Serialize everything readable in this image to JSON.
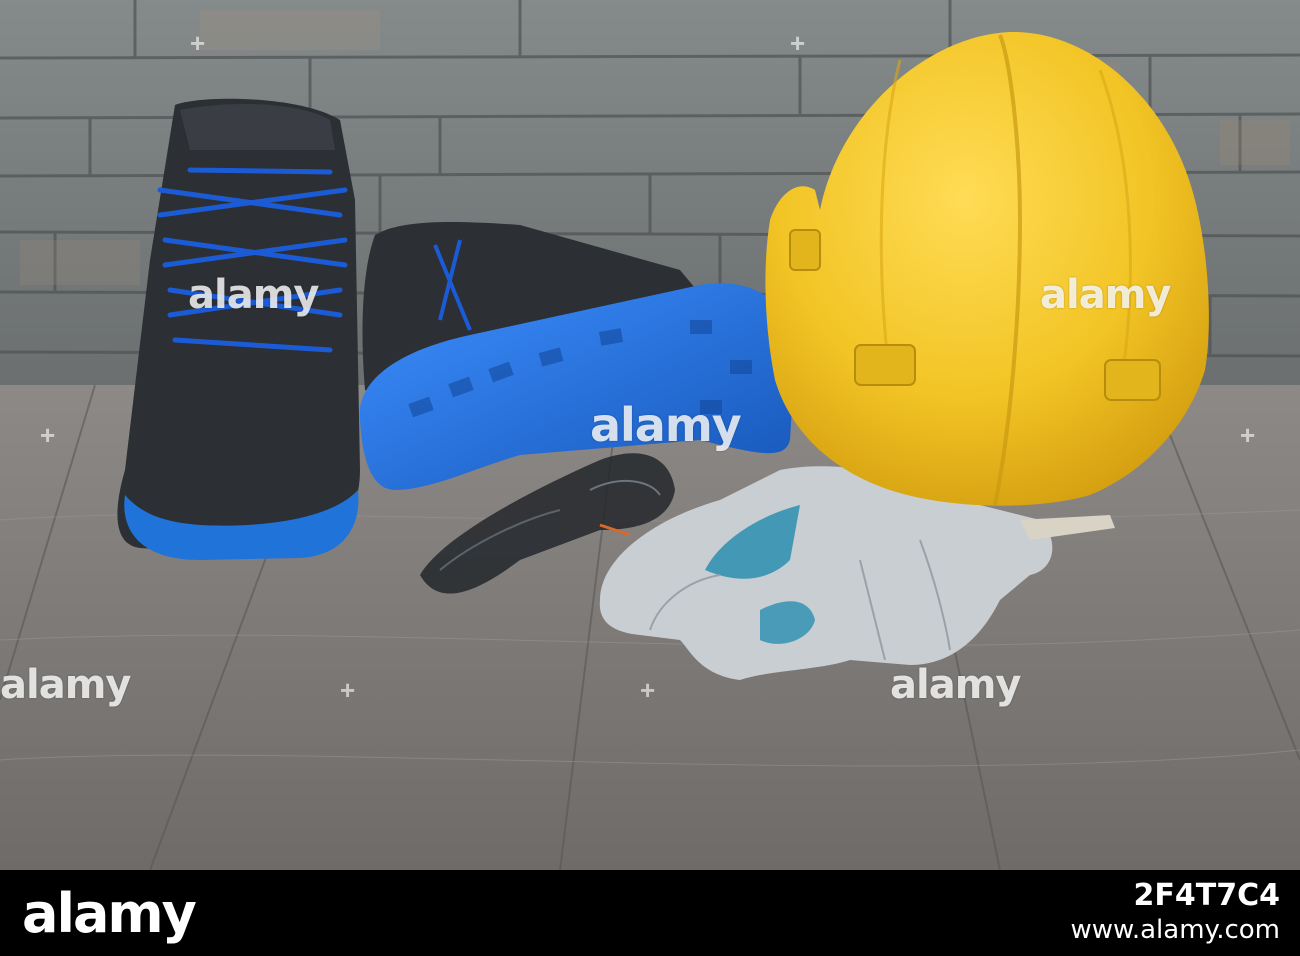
{
  "watermark": {
    "brand": "alamy",
    "center_text": "alamy",
    "tile_texts": [
      "alamy",
      "alamy",
      "alamy",
      "alamy"
    ]
  },
  "footer": {
    "logo": "alamy",
    "image_id": "2F4T7C4",
    "site": "www.alamy.com"
  },
  "scene": {
    "objects": [
      "stone-brick-wall",
      "wood-floor",
      "safety-boot-left",
      "safety-boot-right",
      "safety-glasses",
      "work-gloves",
      "yellow-hard-hat"
    ],
    "colors": {
      "hard_hat": "#f2c425",
      "boot_leather": "#2c2f33",
      "boot_sole": "#1f73d9",
      "laces": "#1c5bd6",
      "gloves": "#c9ced2",
      "glove_accent": "#2b8fb0",
      "floor": "#7d7a78",
      "wall": "#7b7f80"
    }
  }
}
